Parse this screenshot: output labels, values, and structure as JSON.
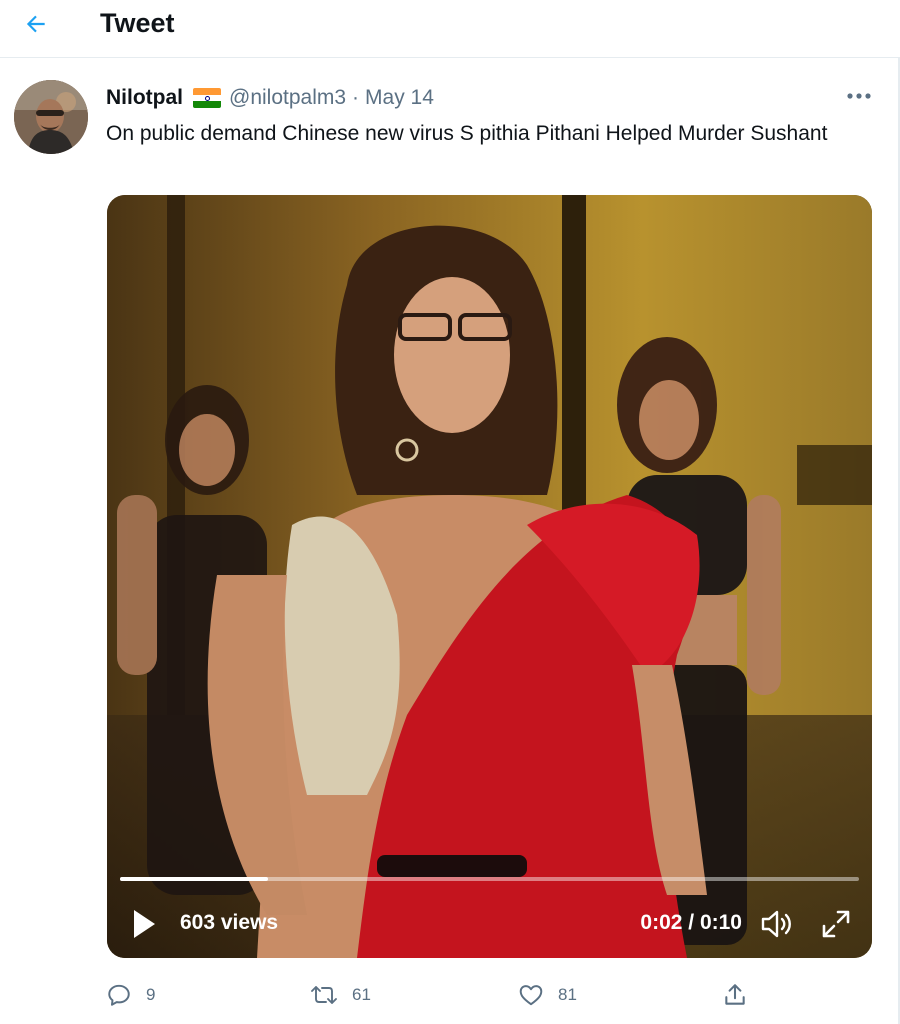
{
  "header": {
    "title": "Tweet",
    "back_icon": "arrow-left-icon"
  },
  "tweet": {
    "display_name": "Nilotpal",
    "flag_icon": "india-flag-icon",
    "handle": "@nilotpalm3",
    "separator": "·",
    "date": "May 14",
    "more_icon": "more-horizontal-icon",
    "text": "On public demand Chinese new virus S pithia Pithani Helped Murder Sushant"
  },
  "video": {
    "views": "603 views",
    "time": "0:02 / 0:10",
    "progress": 0.2,
    "play_icon": "play-icon",
    "volume_icon": "volume-icon",
    "fullscreen_icon": "fullscreen-icon"
  },
  "actions": {
    "reply": {
      "icon": "reply-icon",
      "count": "9"
    },
    "retweet": {
      "icon": "retweet-icon",
      "count": "61"
    },
    "like": {
      "icon": "heart-icon",
      "count": "81"
    },
    "share": {
      "icon": "share-icon"
    }
  },
  "colors": {
    "accent": "#1da1f2",
    "secondary_text": "#5b7083",
    "border": "#e6ecf0"
  }
}
